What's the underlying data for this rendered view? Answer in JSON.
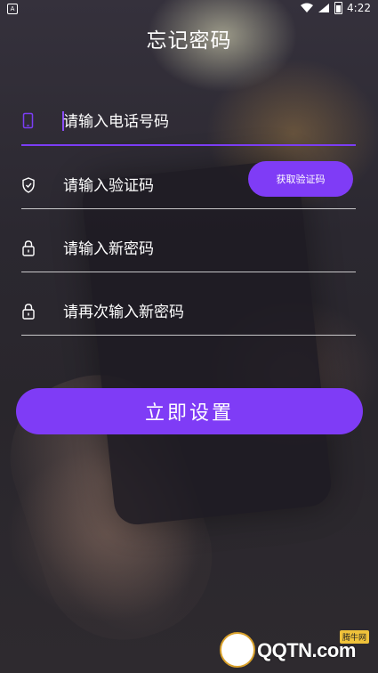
{
  "status_bar": {
    "time": "4:22",
    "left_icon_letter": "A"
  },
  "title": "忘记密码",
  "fields": [
    {
      "name": "phone",
      "placeholder": "请输入电话号码",
      "icon": "phone-icon"
    },
    {
      "name": "code",
      "placeholder": "请输入验证码",
      "icon": "shield-icon"
    },
    {
      "name": "new_password",
      "placeholder": "请输入新密码",
      "icon": "lock-icon"
    },
    {
      "name": "confirm_password",
      "placeholder": "请再次输入新密码",
      "icon": "lock-icon"
    }
  ],
  "get_code_button": "获取验证码",
  "submit_button": "立即设置",
  "watermark": {
    "brand": "QQTN.com",
    "tag": "腾牛网"
  },
  "colors": {
    "accent": "#7f3cf6",
    "active_underline": "#7b3df4"
  }
}
